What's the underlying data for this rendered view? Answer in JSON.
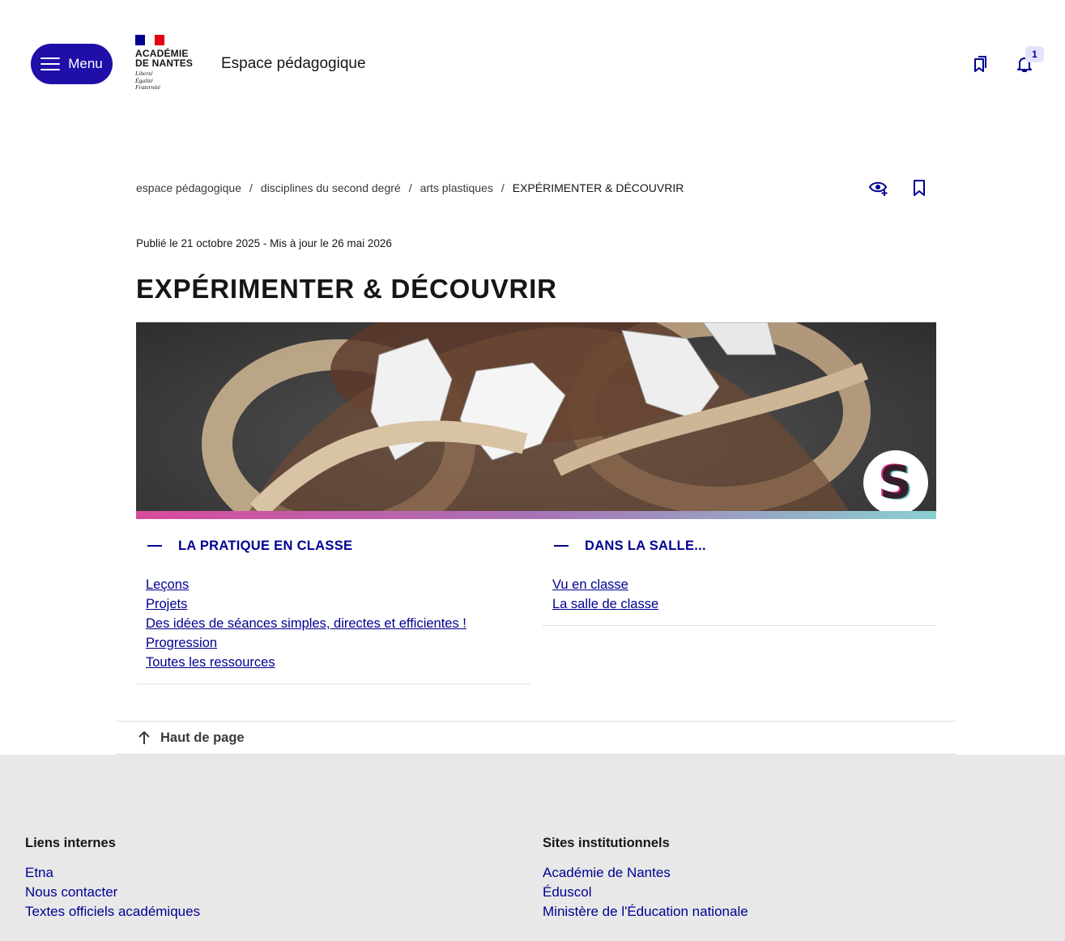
{
  "header": {
    "menu_label": "Menu",
    "logo": {
      "name_line1": "ACADÉMIE",
      "name_line2": "DE NANTES",
      "motto_line1": "Liberté",
      "motto_line2": "Égalité",
      "motto_line3": "Fraternité"
    },
    "site_title": "Espace pédagogique",
    "notification_count": "1"
  },
  "breadcrumb": {
    "items": [
      "espace pédagogique",
      "disciplines du second degré",
      "arts plastiques"
    ],
    "separator": "/",
    "current": "EXPÉRIMENTER & DÉCOUVRIR"
  },
  "page": {
    "published": "Publié le 21 octobre 2025 - Mis à jour le 26 mai 2026",
    "title": "EXPÉRIMENTER & DÉCOUVRIR"
  },
  "sections": [
    {
      "title": "LA PRATIQUE EN CLASSE",
      "links": [
        "Leçons",
        "Projets",
        "Des idées de séances simples, directes et efficientes !",
        "Progression",
        "Toutes les ressources"
      ]
    },
    {
      "title": "DANS LA SALLE...",
      "links": [
        "Vu en classe",
        "La salle de classe"
      ]
    }
  ],
  "back_to_top": "Haut de page",
  "footer": {
    "internal": {
      "title": "Liens internes",
      "links": [
        "Etna",
        "Nous contacter",
        "Textes officiels académiques"
      ]
    },
    "institutional": {
      "title": "Sites institutionnels",
      "links": [
        "Académie de Nantes",
        "Éduscol",
        "Ministère de l'Éducation nationale"
      ]
    }
  },
  "colors": {
    "primary": "#000091",
    "menu_button": "#1f0fa8",
    "footer_bg": "#e8e8e8",
    "flag_blue": "#000091",
    "flag_red": "#e1000f"
  },
  "icons": [
    "menu-icon",
    "bookmarks-icon",
    "bell-icon",
    "eye-plus-icon",
    "bookmark-icon",
    "arrow-up-icon"
  ]
}
